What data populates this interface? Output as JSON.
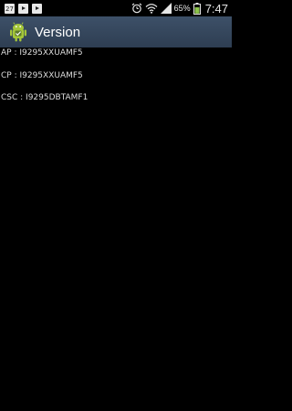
{
  "status_bar": {
    "calendar_day": "27",
    "battery_percent": "65%",
    "time": "7:47",
    "icons": [
      "calendar-icon",
      "play-store-icon",
      "play-store-icon",
      "alarm-icon",
      "wifi-icon",
      "signal-icon",
      "battery-icon"
    ]
  },
  "action_bar": {
    "title": "Version",
    "icon": "android-icon",
    "color": "#34465d"
  },
  "versions": [
    {
      "text": "AP : I9295XXUAMF5"
    },
    {
      "text": "CP : I9295XXUAMF5"
    },
    {
      "text": "CSC : I9295DBTAMF1"
    }
  ]
}
